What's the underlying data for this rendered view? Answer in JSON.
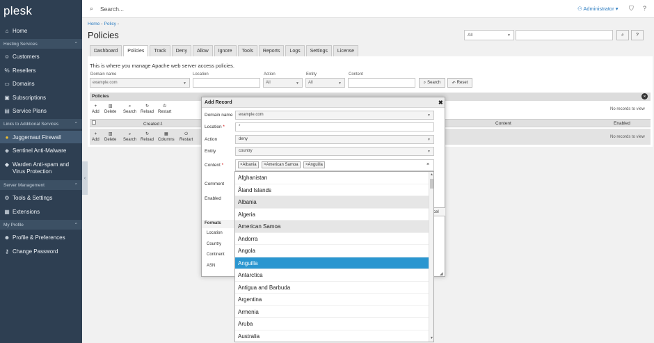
{
  "sidebar": {
    "logo": "plesk",
    "home": "Home",
    "sections": [
      {
        "label": "Hosting Services",
        "items": [
          "Customers",
          "Resellers",
          "Domains",
          "Subscriptions",
          "Service Plans"
        ]
      },
      {
        "label": "Links to Additional Services",
        "items": [
          "Juggernaut Firewall",
          "Sentinel Anti-Malware",
          "Warden Anti-spam and Virus Protection"
        ]
      },
      {
        "label": "Server Management",
        "items": [
          "Tools & Settings",
          "Extensions"
        ]
      },
      {
        "label": "My Profile",
        "items": [
          "Profile & Preferences",
          "Change Password"
        ]
      }
    ]
  },
  "topbar": {
    "search_placeholder": "Search...",
    "user": "Administrator"
  },
  "breadcrumb": [
    "Home",
    "Policy"
  ],
  "page_title": "Policies",
  "top_filter": {
    "select_value": "All"
  },
  "tabs": [
    "Dashboard",
    "Policies",
    "Track",
    "Deny",
    "Allow",
    "Ignore",
    "Tools",
    "Reports",
    "Logs",
    "Settings",
    "License"
  ],
  "active_tab": "Policies",
  "intro": "This is where you manage Apache web server access policies.",
  "filters": {
    "domain_label": "Domain name",
    "domain_value": "example.com",
    "location_label": "Location",
    "action_label": "Action",
    "action_value": "All",
    "entity_label": "Entity",
    "entity_value": "All",
    "content_label": "Content",
    "search_btn": "Search",
    "reset_btn": "Reset"
  },
  "panel": {
    "title": "Policies",
    "toolbar_top": [
      "Add",
      "Delete",
      "Search",
      "Reload",
      "Restart"
    ],
    "toolbar_bottom": [
      "Add",
      "Delete",
      "Search",
      "Reload",
      "Columns",
      "Restart"
    ],
    "no_records": "No records to view",
    "columns": {
      "created": "Created",
      "content": "Content",
      "enabled": "Enabled"
    }
  },
  "dialog": {
    "title": "Add Record",
    "domain_label": "Domain name",
    "domain_value": "example.com",
    "location_label": "Location",
    "location_value": "*",
    "action_label": "Action",
    "action_value": "deny",
    "entity_label": "Entity",
    "entity_value": "country",
    "content_label": "Content",
    "chips": [
      "Albania",
      "American Samoa",
      "Anguilla"
    ],
    "comment_label": "Comment",
    "enabled_label": "Enabled",
    "cancel_partial": "cel",
    "formats_title": "Formats",
    "formats": [
      "Location",
      "Country",
      "Continent",
      "ASN"
    ]
  },
  "dropdown": {
    "options": [
      "Afghanistan",
      "Åland Islands",
      "Albania",
      "Algeria",
      "American Samoa",
      "Andorra",
      "Angola",
      "Anguilla",
      "Antarctica",
      "Antigua and Barbuda",
      "Argentina",
      "Armenia",
      "Aruba",
      "Australia"
    ],
    "selected": [
      "Albania",
      "American Samoa"
    ],
    "highlighted": "Anguilla"
  }
}
